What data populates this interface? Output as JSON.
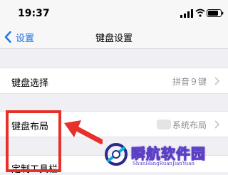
{
  "status_bar": {
    "time": "19:37",
    "icons": [
      "signal-icon",
      "wifi-icon",
      "battery-icon"
    ]
  },
  "nav_bar": {
    "back_label": "设置",
    "title": "键盘设置",
    "accent_color": "#1a73e8"
  },
  "rows": {
    "keyboard_select": {
      "label": "键盘选择",
      "value": "拼音９键"
    },
    "keyboard_layout": {
      "label": "键盘布局",
      "value": "系统布局"
    },
    "custom_toolbar": {
      "label": "定制工具栏"
    }
  },
  "annotation": {
    "highlight_color": "#e8302a"
  },
  "watermark": {
    "title": "瞬航软件园",
    "subtitle": "ShunHangRuanJianYuan"
  }
}
